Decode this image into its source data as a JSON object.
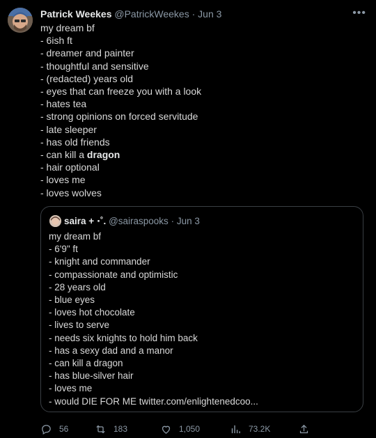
{
  "tweet": {
    "author": {
      "name": "Patrick Weekes",
      "handle": "@PatrickWeekes",
      "separator": " · ",
      "date": "Jun 3"
    },
    "more_icon": "more-icon",
    "intro": "my dream bf",
    "lines": [
      "- 6ish ft",
      "- dreamer and painter",
      "- thoughtful and sensitive",
      "- (redacted) years old",
      "- eyes that can freeze you with a look",
      "- hates tea",
      "- strong opinions on forced servitude",
      "- late sleeper",
      "- has old friends"
    ],
    "dragon_prefix": "- can kill a ",
    "dragon_word": "dragon",
    "lines_after": [
      "- hair optional",
      "- loves me",
      "- loves wolves"
    ]
  },
  "quote": {
    "name": "saira + ⋅˚.",
    "handle": "@sairaspooks",
    "separator": " · ",
    "date": "Jun 3",
    "intro": "my dream bf",
    "lines": [
      "- 6'9\" ft",
      "- knight and commander",
      "- compassionate and optimistic",
      "- 28 years old",
      "- blue eyes",
      "- loves hot chocolate",
      "- lives to serve",
      "- needs six knights to hold him back",
      "- has a sexy dad and a manor",
      "- can kill a dragon",
      "- has blue-silver hair",
      "- loves me",
      "- would DIE FOR ME twitter.com/enlightenedcoo..."
    ]
  },
  "actions": {
    "reply": {
      "icon": "reply-icon",
      "count": "56"
    },
    "retweet": {
      "icon": "retweet-icon",
      "count": "183"
    },
    "like": {
      "icon": "heart-icon",
      "count": "1,050"
    },
    "analytics": {
      "icon": "analytics-icon",
      "count": "73.2K"
    },
    "share": {
      "icon": "share-icon"
    }
  },
  "colors": {
    "background": "#000000",
    "text": "#d9d9d9",
    "muted": "#8b98a5",
    "border": "#3a3f44"
  }
}
